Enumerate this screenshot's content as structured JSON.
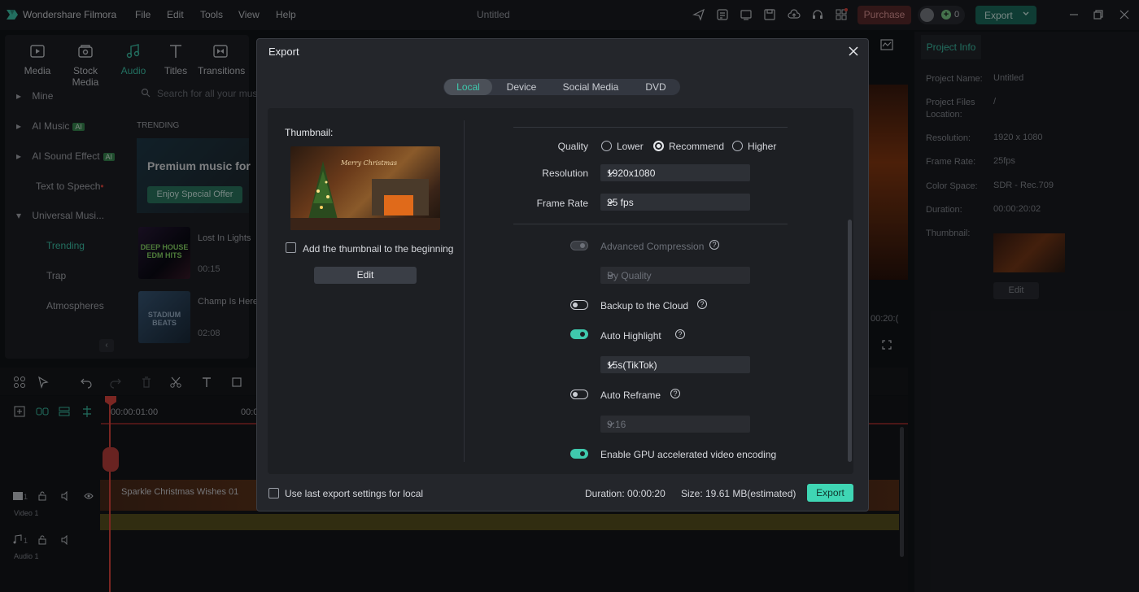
{
  "app": {
    "name": "Wondershare Filmora",
    "window_title": "Untitled",
    "menu": [
      "File",
      "Edit",
      "Tools",
      "View",
      "Help"
    ],
    "purchase_label": "Purchase",
    "credits": "0",
    "export_label": "Export"
  },
  "media_panel": {
    "tabs": [
      {
        "label": "Media",
        "icon": "media-icon"
      },
      {
        "label": "Stock Media",
        "icon": "stock-media-icon"
      },
      {
        "label": "Audio",
        "icon": "audio-icon"
      },
      {
        "label": "Titles",
        "icon": "titles-icon"
      },
      {
        "label": "Transitions",
        "icon": "transitions-icon"
      }
    ],
    "active_tab": "Audio",
    "categories": [
      "Mine",
      "AI Music",
      "AI Sound Effect",
      "Text to Speech",
      "Universal Musi..."
    ],
    "ai_badge": "AI",
    "subcategories": [
      "Trending",
      "Trap",
      "Atmospheres"
    ],
    "search_placeholder": "Search for all your music",
    "trending_label": "TRENDING",
    "banner_title": "Premium music for",
    "banner_button": "Enjoy Special Offer",
    "tracks": [
      {
        "title": "Lost In Lights",
        "duration": "00:15",
        "cover_text": "DEEP HOUSE EDM HITS"
      },
      {
        "title": "Champ Is Here",
        "duration": "02:08",
        "cover_text": "STADIUM BEATS"
      }
    ]
  },
  "project_info": {
    "tab_label": "Project Info",
    "fields": [
      {
        "label": "Project Name:",
        "value": "Untitled"
      },
      {
        "label": "Project Files Location:",
        "value": "/"
      },
      {
        "label": "Resolution:",
        "value": "1920 x 1080"
      },
      {
        "label": "Frame Rate:",
        "value": "25fps"
      },
      {
        "label": "Color Space:",
        "value": "SDR - Rec.709"
      },
      {
        "label": "Duration:",
        "value": "00:00:20:02"
      },
      {
        "label": "Thumbnail:",
        "value": ""
      }
    ],
    "edit_label": "Edit"
  },
  "preview": {
    "time": "00:20:("
  },
  "timeline": {
    "ruler": [
      "00:00:01:00",
      "00:0"
    ],
    "clip_title": "Sparkle Christmas Wishes 01",
    "video_track": {
      "number": "1",
      "label": "Video 1"
    },
    "audio_track": {
      "number": "1",
      "label": "Audio 1"
    }
  },
  "export_dialog": {
    "title": "Export",
    "tabs": [
      "Local",
      "Device",
      "Social Media",
      "DVD"
    ],
    "active_tab": "Local",
    "thumbnail_label": "Thumbnail:",
    "thumbnail_overlay_text": "Merry Christmas",
    "add_thumbnail_label": "Add the thumbnail to the beginning",
    "edit_label": "Edit",
    "quality_label": "Quality",
    "quality_options": [
      "Lower",
      "Recommend",
      "Higher"
    ],
    "quality_selected": "Recommend",
    "resolution_label": "Resolution",
    "resolution_value": "1920x1080",
    "frame_rate_label": "Frame Rate",
    "frame_rate_value": "25 fps",
    "advanced_compression_label": "Advanced Compression",
    "compression_mode": "By Quality",
    "backup_label": "Backup to the Cloud",
    "auto_highlight_label": "Auto Highlight",
    "highlight_value": "15s(TikTok)",
    "auto_reframe_label": "Auto Reframe",
    "reframe_value": "9:16",
    "gpu_label": "Enable GPU accelerated video encoding",
    "use_last_label": "Use last export settings for local",
    "duration_text": "Duration: 00:00:20",
    "size_text": "Size: 19.61 MB(estimated)",
    "export_button": "Export",
    "help_glyph": "?"
  },
  "colors": {
    "accent": "#3fc9ad",
    "export_button": "#3fd6b4",
    "purchase": "#5c2a2c",
    "playhead": "#e0453e"
  }
}
